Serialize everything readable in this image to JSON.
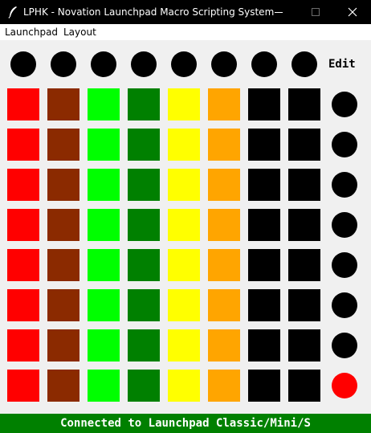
{
  "window": {
    "title": "LPHK - Novation Launchpad Macro Scripting System",
    "icons": {
      "app": "feather-icon",
      "minimize": "minimize-icon",
      "maximize": "maximize-icon",
      "close": "close-icon"
    }
  },
  "menu": {
    "items": [
      "Launchpad",
      "Layout"
    ]
  },
  "grid": {
    "top_buttons": [
      "black",
      "black",
      "black",
      "black",
      "black",
      "black",
      "black",
      "black"
    ],
    "side_buttons": [
      "black",
      "black",
      "black",
      "black",
      "black",
      "black",
      "black",
      "red"
    ],
    "edit_label": "Edit",
    "rows": [
      [
        "red",
        "brown",
        "lime",
        "green",
        "yellow",
        "orange",
        "black",
        "black"
      ],
      [
        "red",
        "brown",
        "lime",
        "green",
        "yellow",
        "orange",
        "black",
        "black"
      ],
      [
        "red",
        "brown",
        "lime",
        "green",
        "yellow",
        "orange",
        "black",
        "black"
      ],
      [
        "red",
        "brown",
        "lime",
        "green",
        "yellow",
        "orange",
        "black",
        "black"
      ],
      [
        "red",
        "brown",
        "lime",
        "green",
        "yellow",
        "orange",
        "black",
        "black"
      ],
      [
        "red",
        "brown",
        "lime",
        "green",
        "yellow",
        "orange",
        "black",
        "black"
      ],
      [
        "red",
        "brown",
        "lime",
        "green",
        "yellow",
        "orange",
        "black",
        "black"
      ],
      [
        "red",
        "brown",
        "lime",
        "green",
        "yellow",
        "orange",
        "black",
        "black"
      ]
    ]
  },
  "colors": {
    "red": "#ff0000",
    "brown": "#8b2a00",
    "lime": "#00ff00",
    "green": "#008000",
    "yellow": "#ffff00",
    "orange": "#ffa500",
    "black": "#000000",
    "status_bg": "#008000",
    "titlebar_bg": "#000000"
  },
  "status": {
    "text": "Connected to Launchpad Classic/Mini/S"
  }
}
